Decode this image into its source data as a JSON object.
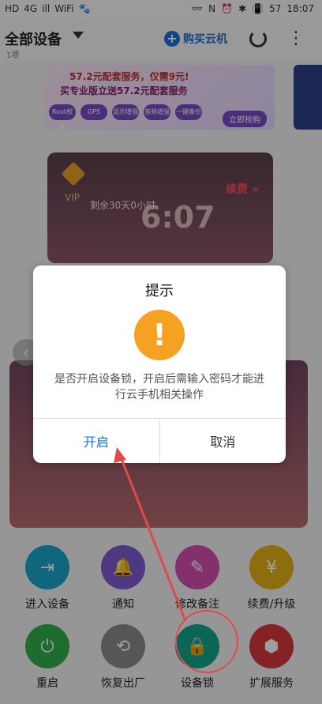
{
  "status": {
    "left": [
      "HD",
      "4G",
      "ill",
      "WiFi",
      "🐾"
    ],
    "right": [
      "👓",
      "N",
      "⏰",
      "✱",
      "📳",
      "57",
      "18:07"
    ]
  },
  "header": {
    "title": "全部设备",
    "subtitle": "1项",
    "buy_label": "购买云机"
  },
  "banner": {
    "line1": "57.2元配套服务，仅需9元!",
    "line2": "买专业版立送57.2元配套服务",
    "chips": [
      "Root权限",
      "GPS",
      "显示增强",
      "音频增强",
      "一键备份"
    ],
    "cta": "立即抢购"
  },
  "device_card": {
    "vip": "VIP",
    "remaining": "剩余30天0小时",
    "time": "6:07",
    "renew": "续费 »"
  },
  "dialog": {
    "title": "提示",
    "icon": "warning-exclamation",
    "message": "是否开启设备锁，开启后需输入密码才能进行云手机相关操作",
    "confirm": "开启",
    "cancel": "取消"
  },
  "actions": [
    {
      "label": "进入设备",
      "icon": "enter-icon",
      "color": "#1aa5c8"
    },
    {
      "label": "通知",
      "icon": "bell-icon",
      "color": "#7c5bd1"
    },
    {
      "label": "修改备注",
      "icon": "edit-icon",
      "color": "#d44eb0"
    },
    {
      "label": "续费/升级",
      "icon": "yen-icon",
      "color": "#e2b219"
    },
    {
      "label": "重启",
      "icon": "power-icon",
      "color": "#31b14d"
    },
    {
      "label": "恢复出厂",
      "icon": "restore-icon",
      "color": "#8b8b8b"
    },
    {
      "label": "设备锁",
      "icon": "lock-icon",
      "color": "#14a58a"
    },
    {
      "label": "扩展服务",
      "icon": "cubes-icon",
      "color": "#d6373e"
    }
  ]
}
